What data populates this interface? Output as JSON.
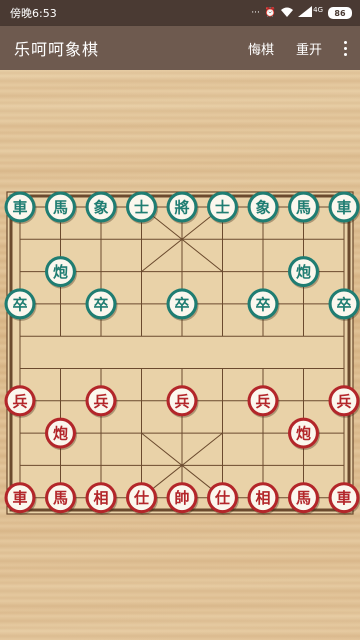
{
  "status_bar": {
    "time": "傍晚6:53",
    "icons": [
      "signal-dots-icon",
      "alarm-icon",
      "wifi-icon",
      "cellular-4g-icon"
    ],
    "network_label": "4G",
    "battery": "86"
  },
  "app_bar": {
    "title": "乐呵呵象棋",
    "undo_label": "悔棋",
    "restart_label": "重开",
    "overflow_icon": "more-vert-icon"
  },
  "board": {
    "columns": 9,
    "rows": 10,
    "colors": {
      "line": "#6b4a2e",
      "board_fill": "#e9d2a8",
      "black_side": "#1f7d72",
      "red_side": "#b3262a",
      "piece_fill": "#fbf7ee"
    },
    "pieces": [
      {
        "side": "black",
        "label": "車",
        "col": 0,
        "row": 0
      },
      {
        "side": "black",
        "label": "馬",
        "col": 1,
        "row": 0
      },
      {
        "side": "black",
        "label": "象",
        "col": 2,
        "row": 0
      },
      {
        "side": "black",
        "label": "士",
        "col": 3,
        "row": 0
      },
      {
        "side": "black",
        "label": "將",
        "col": 4,
        "row": 0
      },
      {
        "side": "black",
        "label": "士",
        "col": 5,
        "row": 0
      },
      {
        "side": "black",
        "label": "象",
        "col": 6,
        "row": 0
      },
      {
        "side": "black",
        "label": "馬",
        "col": 7,
        "row": 0
      },
      {
        "side": "black",
        "label": "車",
        "col": 8,
        "row": 0
      },
      {
        "side": "black",
        "label": "炮",
        "col": 1,
        "row": 2
      },
      {
        "side": "black",
        "label": "炮",
        "col": 7,
        "row": 2
      },
      {
        "side": "black",
        "label": "卒",
        "col": 0,
        "row": 3
      },
      {
        "side": "black",
        "label": "卒",
        "col": 2,
        "row": 3
      },
      {
        "side": "black",
        "label": "卒",
        "col": 4,
        "row": 3
      },
      {
        "side": "black",
        "label": "卒",
        "col": 6,
        "row": 3
      },
      {
        "side": "black",
        "label": "卒",
        "col": 8,
        "row": 3
      },
      {
        "side": "red",
        "label": "兵",
        "col": 0,
        "row": 6
      },
      {
        "side": "red",
        "label": "兵",
        "col": 2,
        "row": 6
      },
      {
        "side": "red",
        "label": "兵",
        "col": 4,
        "row": 6
      },
      {
        "side": "red",
        "label": "兵",
        "col": 6,
        "row": 6
      },
      {
        "side": "red",
        "label": "兵",
        "col": 8,
        "row": 6
      },
      {
        "side": "red",
        "label": "炮",
        "col": 1,
        "row": 7
      },
      {
        "side": "red",
        "label": "炮",
        "col": 7,
        "row": 7
      },
      {
        "side": "red",
        "label": "車",
        "col": 0,
        "row": 9
      },
      {
        "side": "red",
        "label": "馬",
        "col": 1,
        "row": 9
      },
      {
        "side": "red",
        "label": "相",
        "col": 2,
        "row": 9
      },
      {
        "side": "red",
        "label": "仕",
        "col": 3,
        "row": 9
      },
      {
        "side": "red",
        "label": "帥",
        "col": 4,
        "row": 9
      },
      {
        "side": "red",
        "label": "仕",
        "col": 5,
        "row": 9
      },
      {
        "side": "red",
        "label": "相",
        "col": 6,
        "row": 9
      },
      {
        "side": "red",
        "label": "馬",
        "col": 7,
        "row": 9
      },
      {
        "side": "red",
        "label": "車",
        "col": 8,
        "row": 9
      }
    ]
  }
}
